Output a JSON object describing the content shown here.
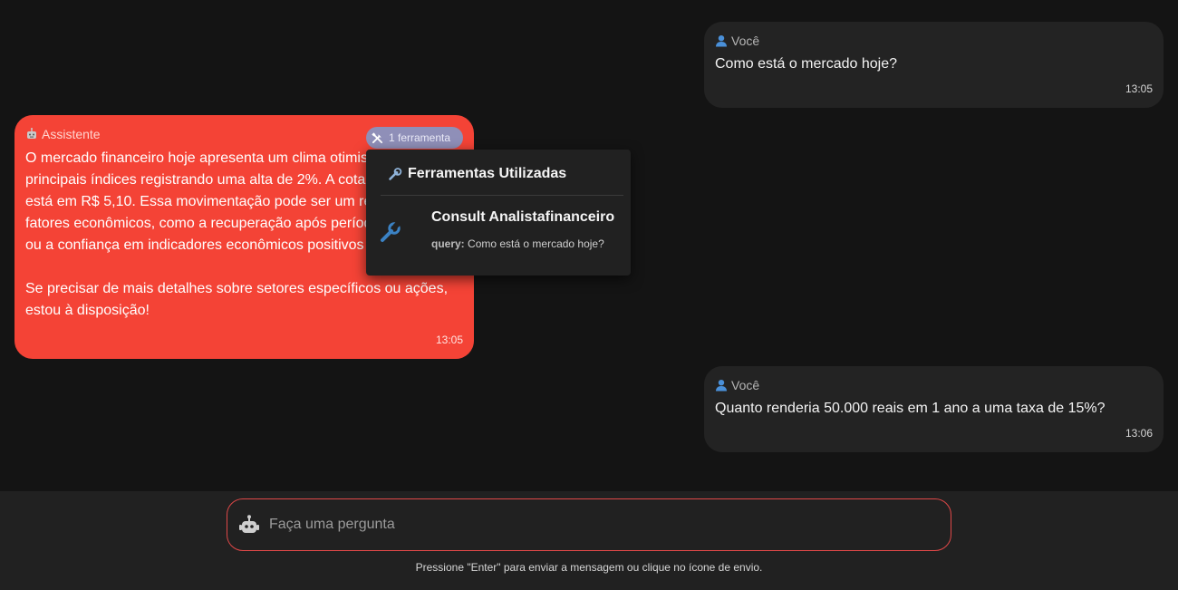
{
  "messages": {
    "m1": {
      "author": "Você",
      "author_icon": "user-icon",
      "text": "Como está o mercado hoje?",
      "time": "13:05"
    },
    "m2": {
      "author": "Assistente",
      "author_icon": "robot-icon",
      "tool_chip_label": "1 ferramenta",
      "text": "O mercado financeiro hoje apresenta um clima otimis\nprincipais índices registrando uma alta de 2%. A cota\nestá em R$ 5,10. Essa movimentação pode ser um re\nfatores econômicos, como a recuperação após períod\nou a confiança em indicadores econômicos positivos\n\nSe precisar de mais detalhes sobre setores específicos ou ações,\nestou à disposição!",
      "time": "13:05"
    },
    "m3": {
      "author": "Você",
      "author_icon": "user-icon",
      "text": "Quanto renderia 50.000 reais em 1 ano a uma taxa de 15%?",
      "time": "13:06"
    }
  },
  "tools_popover": {
    "title": "Ferramentas Utilizadas",
    "title_icon": "wrench-icon",
    "tool": {
      "name": "Consult Analistafinanceiro",
      "arg_key": "query:",
      "arg_value": "Como está o mercado hoje?"
    }
  },
  "input": {
    "placeholder": "Faça uma pergunta",
    "icon": "robot-icon",
    "hint": "Pressione \"Enter\" para enviar a mensagem ou clique no ícone de envio."
  },
  "colors": {
    "background": "#141414",
    "user_bubble": "#232323",
    "assistant_bubble": "#f44336",
    "tool_chip": "#8f8fb8",
    "input_border": "#e04848"
  }
}
